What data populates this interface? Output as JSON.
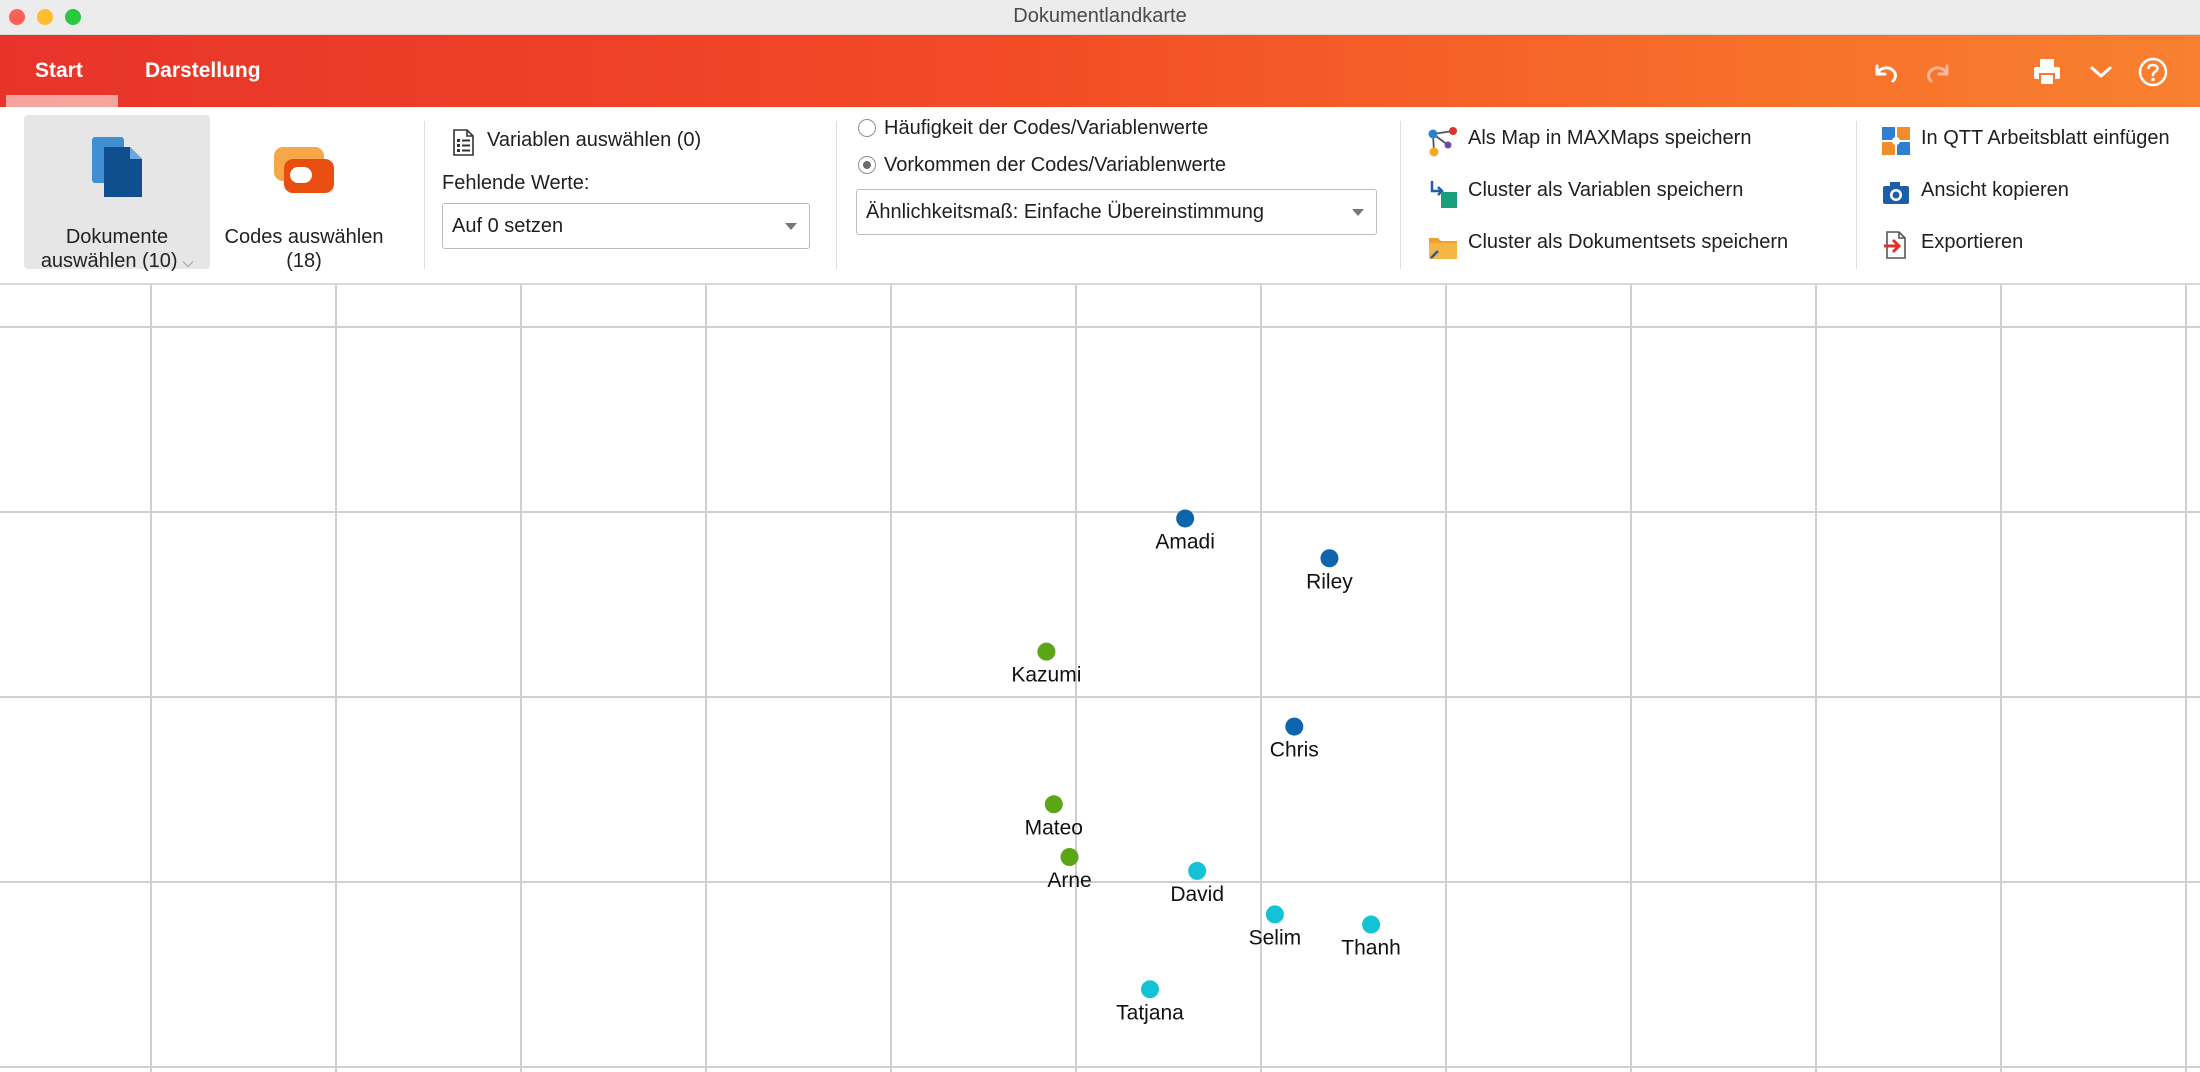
{
  "window": {
    "title": "Dokumentlandkarte"
  },
  "tabs": [
    {
      "label": "Start",
      "active": true
    },
    {
      "label": "Darstellung",
      "active": false
    }
  ],
  "toolbar_icons": [
    "undo-icon",
    "redo-icon",
    "print-icon",
    "chevron-down-icon",
    "help-icon"
  ],
  "ribbon": {
    "dokumente_button": {
      "label_line1": "Dokumente",
      "label_line2": "auswählen (10)",
      "icon": "documents-icon"
    },
    "codes_button": {
      "label_line1": "Codes auswählen",
      "label_line2": "(18)",
      "icon": "codes-icon"
    },
    "variablen_button": {
      "label": "Variablen auswählen (0)",
      "icon": "variables-icon"
    },
    "missing_values": {
      "label": "Fehlende Werte:",
      "value": "Auf 0 setzen"
    },
    "radio_frequency": {
      "label": "Häufigkeit der Codes/Variablenwerte",
      "checked": false
    },
    "radio_occurrence": {
      "label": "Vorkommen der Codes/Variablenwerte",
      "checked": true
    },
    "similarity_select": {
      "value": "Ähnlichkeitsmaß: Einfache Übereinstimmung"
    },
    "save_maxmaps": {
      "label": "Als Map in MAXMaps speichern",
      "icon": "maxmaps-icon"
    },
    "cluster_variables": {
      "label": "Cluster als Variablen speichern",
      "icon": "cluster-variables-icon"
    },
    "cluster_docsets": {
      "label": "Cluster als Dokumentsets speichern",
      "icon": "cluster-docsets-icon"
    },
    "qtt_insert": {
      "label": "In QTT Arbeitsblatt einfügen",
      "icon": "qtt-icon"
    },
    "copy_view": {
      "label": "Ansicht kopieren",
      "icon": "camera-icon"
    },
    "export": {
      "label": "Exportieren",
      "icon": "export-icon"
    }
  },
  "colors": {
    "cluster_dark_blue": "#0f65ad",
    "cluster_green": "#5ba517",
    "cluster_cyan": "#14c2d6",
    "grid": "#cfcfcf"
  },
  "chart_data": {
    "type": "scatter",
    "title": "",
    "xlabel": "",
    "ylabel": "",
    "grid": true,
    "points": [
      {
        "label": "Amadi",
        "x": 0.59,
        "y": 0.965,
        "cluster": 1
      },
      {
        "label": "Riley",
        "x": 1.37,
        "y": 0.75,
        "cluster": 1
      },
      {
        "label": "Chris",
        "x": 1.18,
        "y": -0.16,
        "cluster": 1
      },
      {
        "label": "Kazumi",
        "x": -0.16,
        "y": 0.245,
        "cluster": 2
      },
      {
        "label": "Mateo",
        "x": -0.12,
        "y": -0.58,
        "cluster": 2
      },
      {
        "label": "Arne",
        "x": -0.035,
        "y": -0.865,
        "cluster": 2
      },
      {
        "label": "David",
        "x": 0.655,
        "y": -0.94,
        "cluster": 3
      },
      {
        "label": "Selim",
        "x": 1.075,
        "y": -1.175,
        "cluster": 3
      },
      {
        "label": "Thanh",
        "x": 1.595,
        "y": -1.23,
        "cluster": 3
      },
      {
        "label": "Tatjana",
        "x": 0.4,
        "y": -1.58,
        "cluster": 3
      }
    ]
  }
}
